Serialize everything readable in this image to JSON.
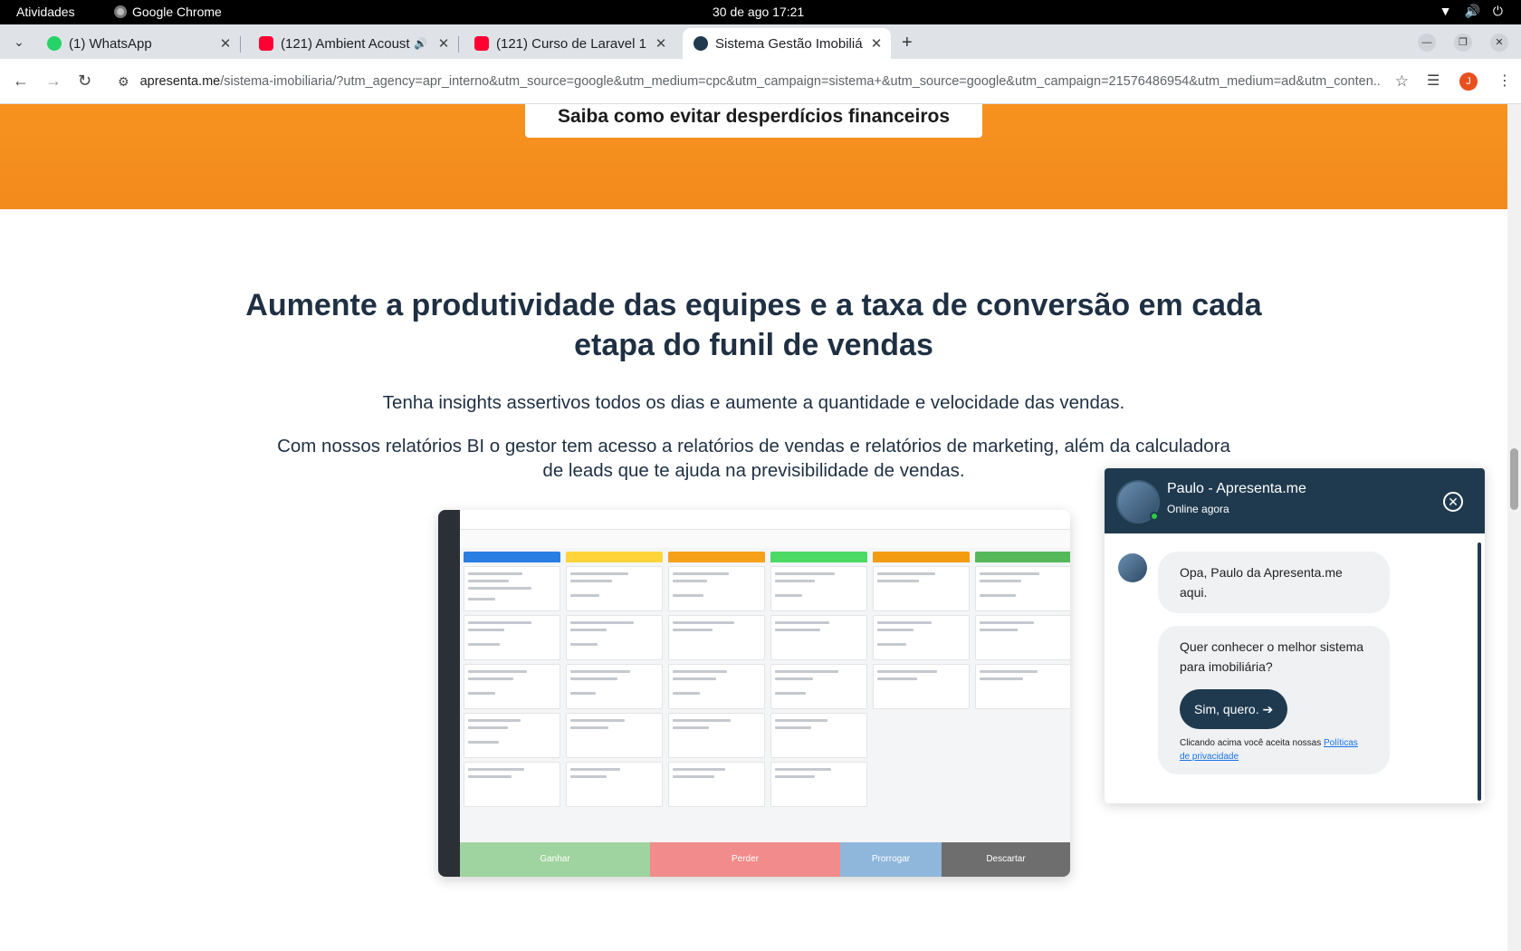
{
  "system_bar": {
    "activities": "Atividades",
    "app_name": "Google Chrome",
    "datetime": "30 de ago  17:21"
  },
  "tabs": [
    {
      "title": "(1) WhatsApp",
      "icon": "whatsapp-icon"
    },
    {
      "title": "(121) Ambient Acoust",
      "icon": "youtube-icon"
    },
    {
      "title": "(121) Curso de Laravel 1",
      "icon": "youtube-icon"
    },
    {
      "title": "Sistema Gestão Imobiliá",
      "icon": "apresenta-icon",
      "active": true
    }
  ],
  "address_bar": {
    "host": "apresenta.me",
    "path": "/sistema-imobiliaria/?utm_agency=apr_interno&utm_source=google&utm_medium=cpc&utm_campaign=sistema+&utm_source=google&utm_campaign=21576486954&utm_medium=ad&utm_conten..."
  },
  "profile": {
    "initial": "J",
    "color": "#e8501d"
  },
  "page": {
    "cta_label": "Saiba como evitar desperdícios financeiros",
    "headline": "Aumente a produtividade das equipes e a taxa de conversão em cada etapa do funil de vendas",
    "subtitle": "Tenha insights assertivos todos os dias e aumente a quantidade e velocidade das vendas.",
    "description": "Com nossos relatórios BI o gestor tem acesso a relatórios de vendas e relatórios de marketing, além da calculadora de leads que te ajuda na previsibilidade de vendas.",
    "colors": {
      "orange_band": "#f7921e",
      "text": "#1f3043"
    }
  },
  "product_screenshot": {
    "columns": [
      "#2a7de1",
      "#ffd43b",
      "#f7a11a",
      "#4cd964",
      "#f39c12",
      "#55b85a"
    ],
    "bottom_buttons": [
      "Ganhar",
      "Perder",
      "Prorrogar",
      "Descartar"
    ],
    "bottom_colors": [
      "#9fd39f",
      "#f28b8b",
      "#8fb7dc",
      "#6e6e6e"
    ]
  },
  "chat": {
    "agent_name": "Paulo - Apresenta.me",
    "status": "Online agora",
    "messages": [
      "Opa, Paulo da Apresenta.me aqui.",
      "Quer conhecer o melhor sistema para imobiliária?"
    ],
    "cta_label": "Sim, quero.",
    "legal_prefix": "Clicando acima você aceita nossas",
    "legal_link": "Políticas de privacidade"
  }
}
